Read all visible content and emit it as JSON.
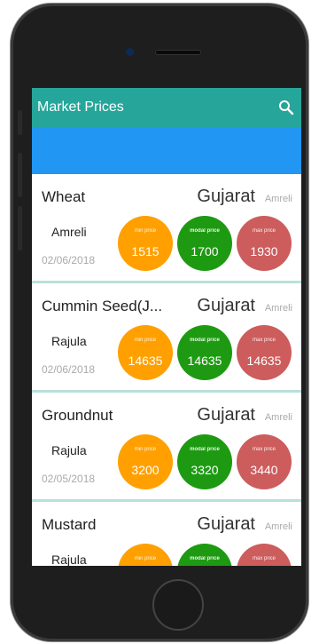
{
  "appbar": {
    "title": "Market Prices"
  },
  "colors": {
    "appbar": "#26a69a",
    "band": "#2196f3",
    "min": "#ffa000",
    "modal": "#1e9a12",
    "max": "#cd5c5c"
  },
  "labels": {
    "min": "min price",
    "modal": "modal price",
    "max": "max price"
  },
  "items": [
    {
      "crop": "Wheat",
      "state": "Gujarat",
      "district": "Amreli",
      "market": "Amreli",
      "date": "02/06/2018",
      "min": "1515",
      "modal": "1700",
      "max": "1930"
    },
    {
      "crop": "Cummin Seed(J...",
      "state": "Gujarat",
      "district": "Amreli",
      "market": "Rajula",
      "date": "02/06/2018",
      "min": "14635",
      "modal": "14635",
      "max": "14635"
    },
    {
      "crop": "Groundnut",
      "state": "Gujarat",
      "district": "Amreli",
      "market": "Rajula",
      "date": "02/05/2018",
      "min": "3200",
      "modal": "3320",
      "max": "3440"
    },
    {
      "crop": "Mustard",
      "state": "Gujarat",
      "district": "Amreli",
      "market": "Rajula",
      "date": "",
      "min": "",
      "modal": "",
      "max": ""
    }
  ]
}
